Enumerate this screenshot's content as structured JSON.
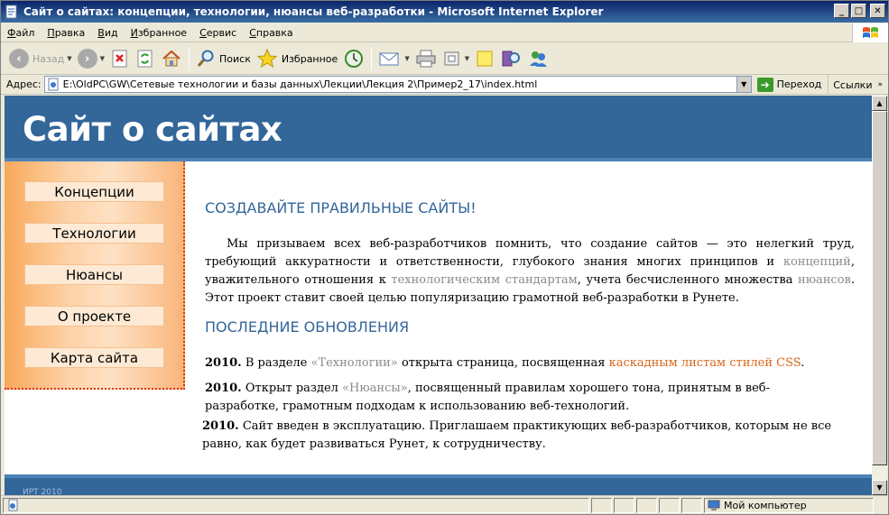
{
  "window": {
    "title": "Сайт о сайтах: концепции, технологии, нюансы веб-разработки - Microsoft Internet Explorer",
    "minimize": "_",
    "maximize": "□",
    "close": "✕"
  },
  "menubar": {
    "items": [
      "Файл",
      "Правка",
      "Вид",
      "Избранное",
      "Сервис",
      "Справка"
    ]
  },
  "toolbar": {
    "back_label": "Назад",
    "search_label": "Поиск",
    "favorites_label": "Избранное"
  },
  "addressbar": {
    "label": "Адрес:",
    "url": "E:\\OldPC\\GW\\Сетевые технологии и базы данных\\Лекции\\Лекция 2\\Пример2_17\\index.html",
    "go_label": "Переход",
    "links_label": "Ссылки"
  },
  "site": {
    "header_title": "Сайт о сайтах",
    "nav": [
      "Концепции",
      "Технологии",
      "Нюансы",
      "О проекте",
      "Карта сайта"
    ],
    "heading1": "СОЗДАВАЙТЕ ПРАВИЛЬНЫЕ САЙТЫ!",
    "intro": {
      "p1": "Мы призываем всех веб-разработчиков помнить, что создание сайтов — это нелегкий труд, требующий аккуратности и ответственности, глубокого знания многих принципов и ",
      "link1": "концепций",
      "p2": ", уважительного отношения к ",
      "link2": "технологическим стандартам",
      "p3": ", учета бесчисленного множества ",
      "link3": "нюансов",
      "p4": ". Этот проект ставит своей целью популяризацию грамотной веб-разработки в Рунете."
    },
    "heading2": "ПОСЛЕДНИЕ ОБНОВЛЕНИЯ",
    "news": [
      {
        "year": "2010.",
        "t1": " В разделе ",
        "link": "«Технологии»",
        "t2": " открыта страница, посвященная ",
        "link2": "каскадным листам стилей CSS",
        "t3": "."
      },
      {
        "year": "2010.",
        "t1": " Открыт раздел ",
        "link": "«Нюансы»",
        "t2": ", посвященный правилам хорошего тона, принятым в веб-разработке, грамотным подходам к использованию веб-технологий."
      },
      {
        "year": "2010.",
        "t1": " Сайт введен в эксплуатацию. Приглашаем практикующих веб-разработчиков, которым не все равно, как будет развиваться Рунет, к сотрудничеству."
      }
    ],
    "footer": "ИРТ 2010"
  },
  "statusbar": {
    "zone": "Мой компьютер"
  },
  "colors": {
    "site_blue": "#336699",
    "sidebar_orange": "#f8a85a",
    "link_orange": "#d9661a",
    "link_grey": "#8a8a8a"
  }
}
